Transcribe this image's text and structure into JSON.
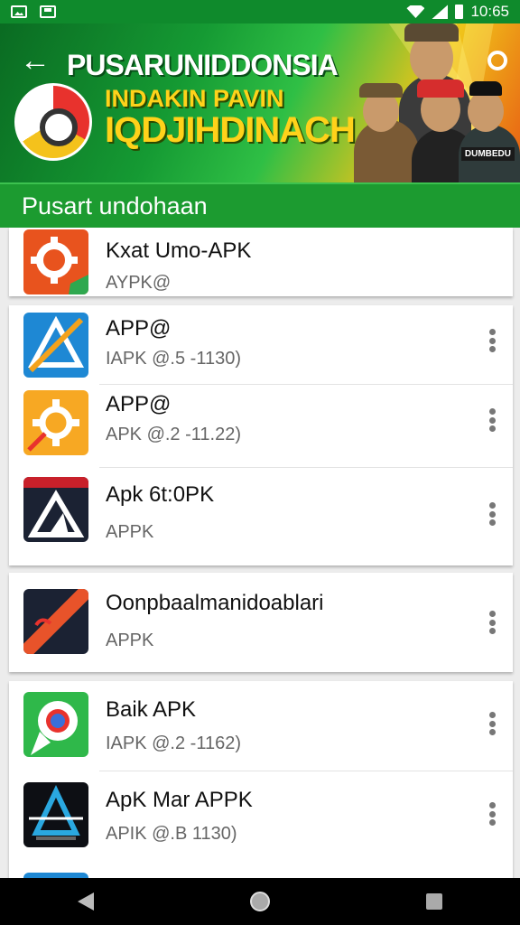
{
  "status_bar": {
    "time": "10:65"
  },
  "banner": {
    "title": "PUSARUNIDDONSIA",
    "subtitle_line1": "INDAKIN PAVIN",
    "subtitle_line2": "IQDJIHDINACH",
    "badge": "DUMBEDU"
  },
  "section": {
    "title": "Pusart undohaan"
  },
  "apps": [
    {
      "name": "Kxat Umo-APK",
      "sub": "AYPK@"
    },
    {
      "name": "APP@",
      "sub": "IAPK @.5 -1130)"
    },
    {
      "name": "APP@",
      "sub": "APK @.2 -11.22)"
    },
    {
      "name": "Apk 6t:0PK",
      "sub": "APPK"
    },
    {
      "name": "Oonpbaalmanidoablari",
      "sub": "APPK"
    },
    {
      "name": "Baik APK",
      "sub": "IAPK @.2 -1162)"
    },
    {
      "name": "ApK Mar APPK",
      "sub": "APIK @.B 1130)"
    },
    {
      "name": "",
      "sub": ""
    }
  ],
  "icons": {
    "app1": "orange-gear-icon",
    "app2": "blue-triangle-icon",
    "app3": "yellow-gear-icon",
    "app4": "dark-a-logo-icon",
    "app5": "red-stripe-icon",
    "app6": "green-chrome-icon",
    "app7": "blue-a-logo-icon"
  },
  "colors": {
    "primary_green": "#1c9b30",
    "status_green": "#0f8a2c"
  }
}
